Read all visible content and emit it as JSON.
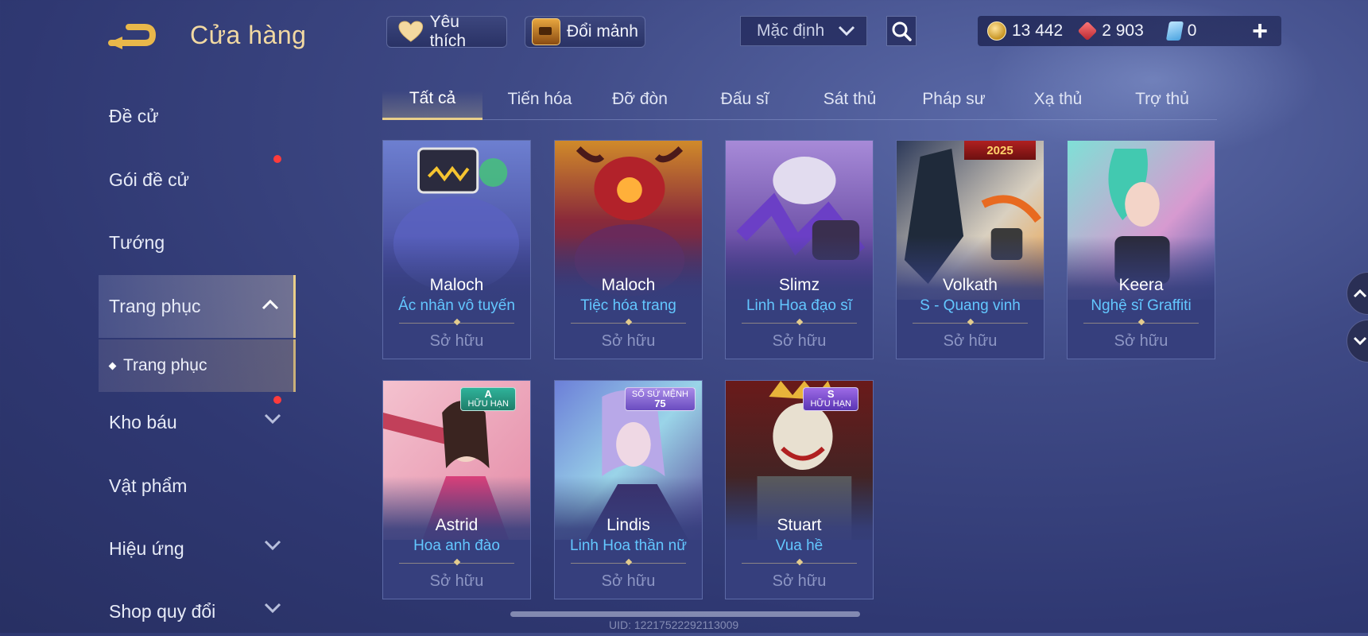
{
  "header": {
    "title": "Cửa hàng",
    "favorite_label": "Yêu thích",
    "exchange_label": "Đổi mảnh",
    "sort": {
      "selected": "Mặc định"
    },
    "currencies": {
      "gold": "13 442",
      "ruby": "2 903",
      "voucher": "0"
    },
    "add_symbol": "+"
  },
  "sidebar": {
    "items": [
      {
        "label": "Đề cử"
      },
      {
        "label": "Gói đề cử"
      },
      {
        "label": "Tướng"
      },
      {
        "label": "Trang phục"
      },
      {
        "label": "Kho báu"
      },
      {
        "label": "Vật phẩm"
      },
      {
        "label": "Hiệu ứng"
      },
      {
        "label": "Shop quy đổi"
      }
    ],
    "subitem": "Trang phục"
  },
  "tabs": [
    "Tất cả",
    "Tiến hóa",
    "Đỡ đòn",
    "Đấu sĩ",
    "Sát thủ",
    "Pháp sư",
    "Xạ thủ",
    "Trợ thủ"
  ],
  "cards": [
    {
      "hero": "Maloch",
      "skin": "Ác nhân vô tuyến",
      "status": "Sở hữu"
    },
    {
      "hero": "Maloch",
      "skin": "Tiệc hóa trang",
      "status": "Sở hữu"
    },
    {
      "hero": "Slimz",
      "skin": "Linh Hoa đạo sĩ",
      "status": "Sở hữu"
    },
    {
      "hero": "Volkath",
      "skin": "S - Quang vinh",
      "status": "Sở hữu",
      "ribbon": "2025"
    },
    {
      "hero": "Keera",
      "skin": "Nghệ sĩ Graffiti",
      "status": "Sở hữu"
    },
    {
      "hero": "Astrid",
      "skin": "Hoa anh đào",
      "status": "Sở hữu",
      "badge_top": "A",
      "badge_bottom": "HỮU HẠN"
    },
    {
      "hero": "Lindis",
      "skin": "Linh Hoa thần nữ",
      "status": "Sở hữu",
      "badge_top": "SỐ SỨ MỆNH",
      "badge_bottom": "75"
    },
    {
      "hero": "Stuart",
      "skin": "Vua hề",
      "status": "Sở hữu",
      "badge_top": "S",
      "badge_bottom": "HỮU HẠN"
    }
  ],
  "footer": {
    "uid": "UID: 12217522292113009"
  },
  "colors": {
    "accent_gold": "#e9cf8a",
    "skin_blue": "#63c7ff",
    "notify_red": "#ff3b3b"
  }
}
